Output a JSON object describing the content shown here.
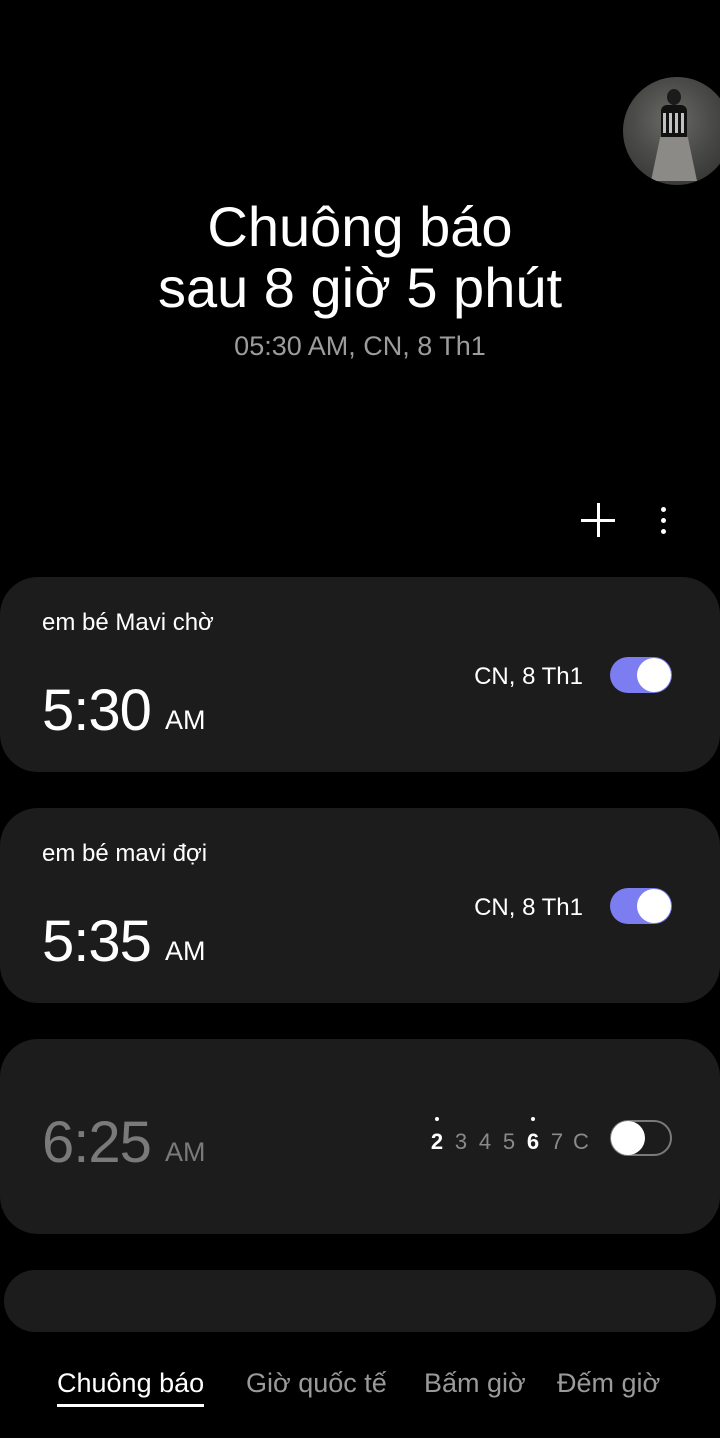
{
  "header": {
    "title_line1": "Chuông báo",
    "title_line2": "sau 8 giờ 5 phút",
    "subtitle": "05:30 AM, CN, 8 Th1"
  },
  "toolbar": {
    "add_icon": "plus-icon",
    "more_icon": "more-vertical-icon"
  },
  "alarms": [
    {
      "label": "em bé Mavi chờ",
      "time": "5:30",
      "ampm": "AM",
      "date": "CN, 8 Th1",
      "enabled": true
    },
    {
      "label": "em bé mavi đợi",
      "time": "5:35",
      "ampm": "AM",
      "date": "CN, 8 Th1",
      "enabled": true
    },
    {
      "label": "",
      "time": "6:25",
      "ampm": "AM",
      "days": [
        "2",
        "3",
        "4",
        "5",
        "6",
        "7",
        "C"
      ],
      "active_days": [
        "2",
        "6"
      ],
      "enabled": false
    }
  ],
  "tabs": [
    {
      "label": "Chuông báo",
      "active": true
    },
    {
      "label": "Giờ quốc tế",
      "active": false
    },
    {
      "label": "Bấm giờ",
      "active": false
    },
    {
      "label": "Đếm giờ",
      "active": false
    }
  ],
  "colors": {
    "background": "#000000",
    "card": "#1c1c1c",
    "toggle_on": "#7b7df0",
    "muted_text": "#9c9c9c"
  }
}
